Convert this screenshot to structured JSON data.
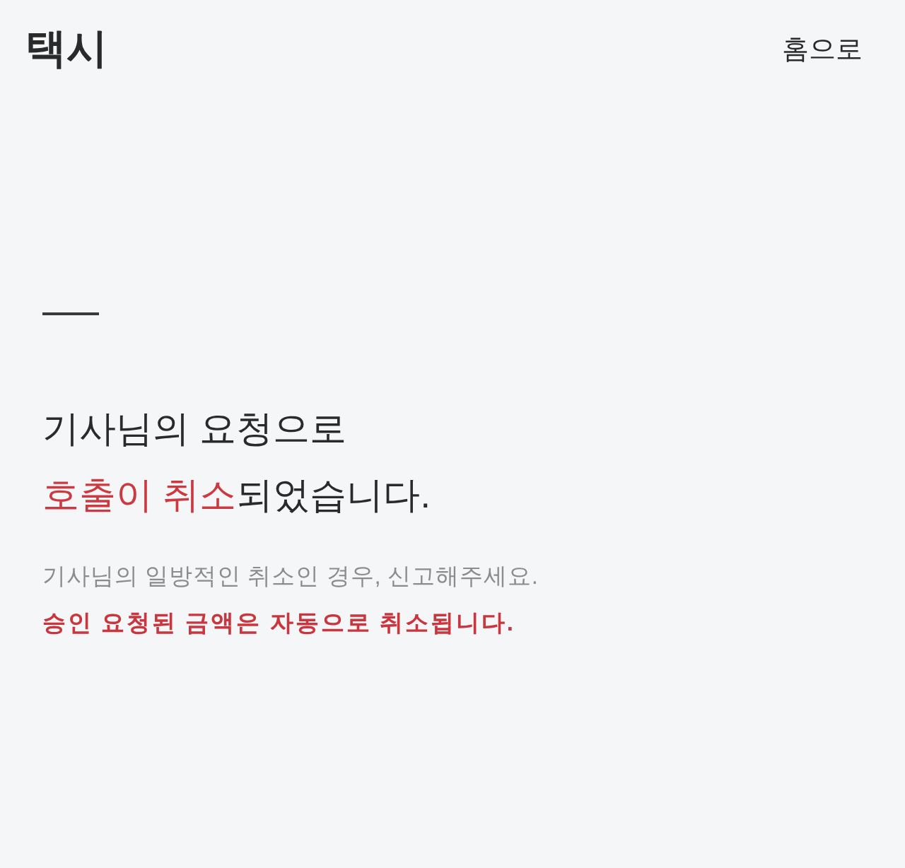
{
  "header": {
    "title": "택시",
    "home_link": "홈으로"
  },
  "headline": {
    "lines": [
      [
        {
          "text": "기사님의 요청으로",
          "highlight": false
        }
      ],
      [
        {
          "text": "호출이 취소",
          "highlight": true
        },
        {
          "text": "되었습니다.",
          "highlight": false
        }
      ]
    ]
  },
  "notices": [
    {
      "text": "기사님의 일방적인 취소인 경우, 신고해주세요.",
      "kind": "info"
    },
    {
      "text": "승인 요청된 금액은 자동으로 취소됩니다.",
      "kind": "warning"
    }
  ]
}
